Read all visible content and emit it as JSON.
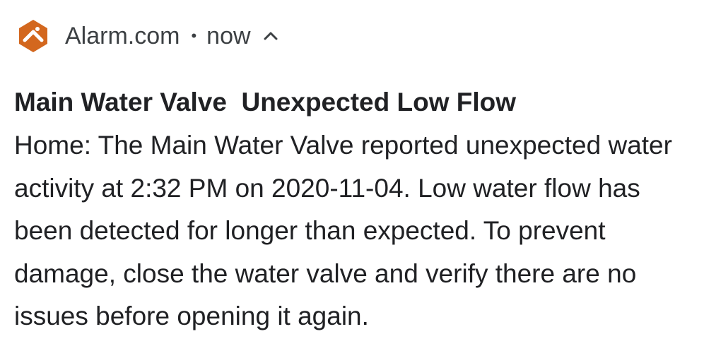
{
  "notification": {
    "app_name": "Alarm.com",
    "separator": "•",
    "timestamp": "now",
    "expand_icon": "chevron-up-icon",
    "app_icon": "alarm-com-logo-icon",
    "brand_color": "#d3671e",
    "title": "Main Water Valve  Unexpected Low Flow",
    "body": "Home: The Main Water Valve reported unexpected water activity at 2:32 PM on 2020-11-04. Low water flow has been detected for longer than expected. To prevent damage, close the water valve and verify there are no issues before opening it again."
  }
}
